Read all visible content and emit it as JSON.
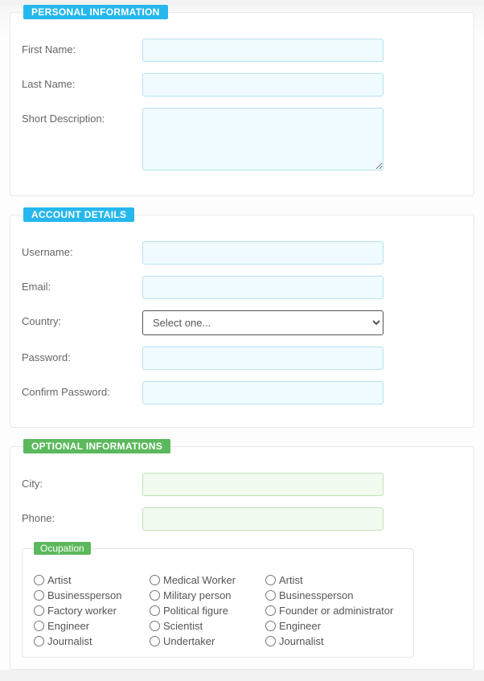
{
  "sections": {
    "personal": {
      "heading": "Personal Information",
      "fields": {
        "first_name": {
          "label": "First Name:",
          "value": ""
        },
        "last_name": {
          "label": "Last Name:",
          "value": ""
        },
        "short_desc": {
          "label": "Short Description:",
          "value": ""
        }
      }
    },
    "account": {
      "heading": "Account Details",
      "fields": {
        "username": {
          "label": "Username:",
          "value": ""
        },
        "email": {
          "label": "Email:",
          "value": ""
        },
        "country": {
          "label": "Country:",
          "selected": "Select one..."
        },
        "password": {
          "label": "Password:",
          "value": ""
        },
        "confirm": {
          "label": "Confirm Password:",
          "value": ""
        }
      }
    },
    "optional": {
      "heading": "Optional Informations",
      "fields": {
        "city": {
          "label": "City:",
          "value": ""
        },
        "phone": {
          "label": "Phone:",
          "value": ""
        }
      },
      "occupation": {
        "heading": "Ocupation",
        "columns": [
          [
            "Artist",
            "Businessperson",
            "Factory worker",
            "Engineer",
            "Journalist"
          ],
          [
            "Medical Worker",
            "Military person",
            "Political figure",
            "Scientist",
            "Undertaker"
          ],
          [
            "Artist",
            "Businessperson",
            "Founder or administrator",
            "Engineer",
            "Journalist"
          ]
        ]
      }
    }
  }
}
